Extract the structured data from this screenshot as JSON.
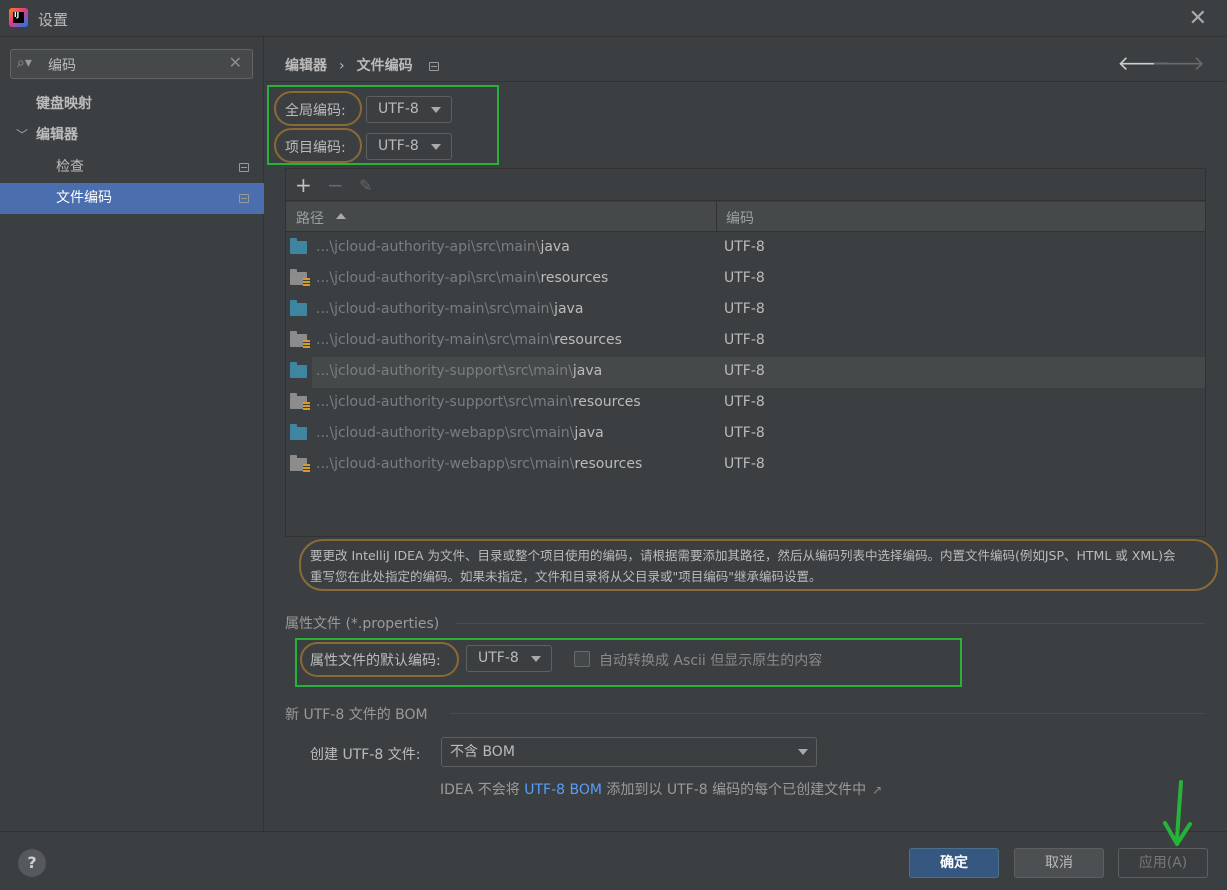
{
  "window": {
    "title": "设置",
    "close_icon": "close-icon"
  },
  "search": {
    "value": "编码"
  },
  "sidebar": {
    "items": [
      {
        "label": "键盘映射"
      },
      {
        "label": "编辑器"
      },
      {
        "label": "检查"
      },
      {
        "label": "文件编码"
      }
    ]
  },
  "breadcrumb": {
    "parent": "编辑器",
    "separator": "›",
    "current": "文件编码"
  },
  "encoding": {
    "global_label": "全局编码:",
    "global_value": "UTF-8",
    "project_label": "项目编码:",
    "project_value": "UTF-8"
  },
  "table": {
    "columns": [
      "路径",
      "编码"
    ],
    "rows": [
      {
        "prefix": "...\\jcloud-authority-api\\src\\main\\",
        "leaf": "java",
        "encoding": "UTF-8",
        "kind": "source"
      },
      {
        "prefix": "...\\jcloud-authority-api\\src\\main\\",
        "leaf": "resources",
        "encoding": "UTF-8",
        "kind": "resources"
      },
      {
        "prefix": "...\\jcloud-authority-main\\src\\main\\",
        "leaf": "java",
        "encoding": "UTF-8",
        "kind": "source"
      },
      {
        "prefix": "...\\jcloud-authority-main\\src\\main\\",
        "leaf": "resources",
        "encoding": "UTF-8",
        "kind": "resources"
      },
      {
        "prefix": "...\\jcloud-authority-support\\src\\main\\",
        "leaf": "java",
        "encoding": "UTF-8",
        "kind": "source"
      },
      {
        "prefix": "...\\jcloud-authority-support\\src\\main\\",
        "leaf": "resources",
        "encoding": "UTF-8",
        "kind": "resources"
      },
      {
        "prefix": "...\\jcloud-authority-webapp\\src\\main\\",
        "leaf": "java",
        "encoding": "UTF-8",
        "kind": "source"
      },
      {
        "prefix": "...\\jcloud-authority-webapp\\src\\main\\",
        "leaf": "resources",
        "encoding": "UTF-8",
        "kind": "resources"
      }
    ]
  },
  "note": {
    "line1": "要更改 IntelliJ IDEA 为文件、目录或整个项目使用的编码，请根据需要添加其路径，然后从编码列表中选择编码。内置文件编码(例如JSP、HTML 或 XML)会",
    "line2": "重写您在此处指定的编码。如果未指定，文件和目录将从父目录或\"项目编码\"继承编码设置。"
  },
  "properties": {
    "section_title": "属性文件 (*.properties)",
    "default_label": "属性文件的默认编码:",
    "default_value": "UTF-8",
    "ascii_label": "自动转换成 Ascii 但显示原生的内容"
  },
  "bom": {
    "section_title": "新 UTF-8 文件的 BOM",
    "create_label": "创建 UTF-8 文件:",
    "create_value": "不含 BOM",
    "info_prefix": "IDEA 不会将 ",
    "info_link": "UTF-8 BOM",
    "info_suffix": " 添加到以 UTF-8 编码的每个已创建文件中"
  },
  "footer": {
    "help": "?",
    "ok": "确定",
    "cancel": "取消",
    "apply": "应用(A)"
  },
  "colors": {
    "accent": "#4b6eaf",
    "annotation_box": "#27b33a",
    "annotation_oval": "#8a6a34",
    "link": "#589df6"
  }
}
